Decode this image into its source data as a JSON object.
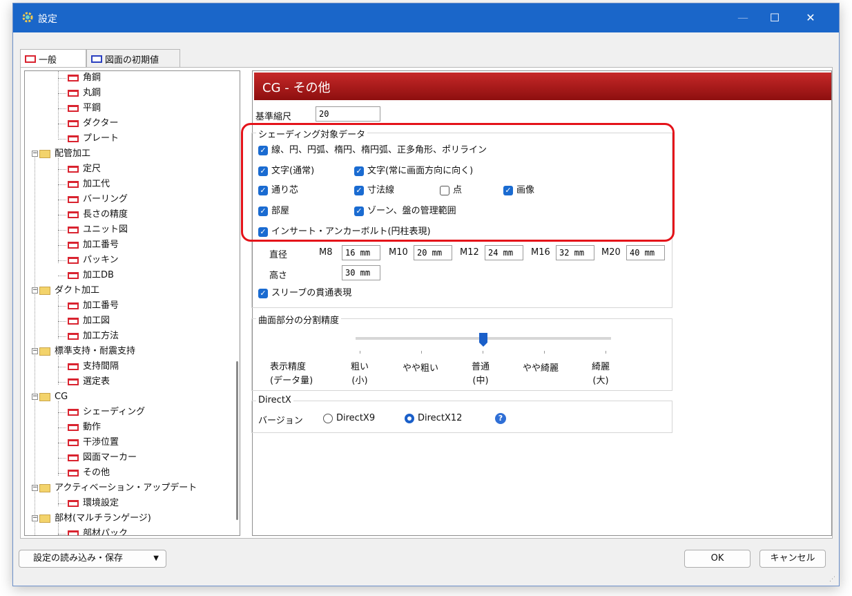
{
  "window": {
    "title": "設定",
    "min_glyph": "—",
    "max_glyph": "☐",
    "close_glyph": "✕"
  },
  "tabs": [
    {
      "label": "一般",
      "active": true
    },
    {
      "label": "図面の初期値",
      "active": false
    }
  ],
  "tree": {
    "items": [
      {
        "label": "角鋼",
        "kind": "leaf"
      },
      {
        "label": "丸鋼",
        "kind": "leaf"
      },
      {
        "label": "平鋼",
        "kind": "leaf"
      },
      {
        "label": "ダクター",
        "kind": "leaf"
      },
      {
        "label": "プレート",
        "kind": "leaf"
      },
      {
        "label": "配管加工",
        "kind": "folder"
      },
      {
        "label": "定尺",
        "kind": "leaf"
      },
      {
        "label": "加工代",
        "kind": "leaf"
      },
      {
        "label": "バーリング",
        "kind": "leaf"
      },
      {
        "label": "長さの精度",
        "kind": "leaf"
      },
      {
        "label": "ユニット図",
        "kind": "leaf"
      },
      {
        "label": "加工番号",
        "kind": "leaf"
      },
      {
        "label": "パッキン",
        "kind": "leaf"
      },
      {
        "label": "加工DB",
        "kind": "leaf"
      },
      {
        "label": "ダクト加工",
        "kind": "folder"
      },
      {
        "label": "加工番号",
        "kind": "leaf"
      },
      {
        "label": "加工図",
        "kind": "leaf"
      },
      {
        "label": "加工方法",
        "kind": "leaf"
      },
      {
        "label": "標準支持・耐震支持",
        "kind": "folder"
      },
      {
        "label": "支持間隔",
        "kind": "leaf"
      },
      {
        "label": "選定表",
        "kind": "leaf"
      },
      {
        "label": "CG",
        "kind": "folder"
      },
      {
        "label": "シェーディング",
        "kind": "leaf"
      },
      {
        "label": "動作",
        "kind": "leaf"
      },
      {
        "label": "干渉位置",
        "kind": "leaf"
      },
      {
        "label": "図面マーカー",
        "kind": "leaf"
      },
      {
        "label": "その他",
        "kind": "leaf"
      },
      {
        "label": "アクティベーション・アップデート",
        "kind": "folder"
      },
      {
        "label": "環境設定",
        "kind": "leaf"
      },
      {
        "label": "部材(マルチランゲージ)",
        "kind": "folder"
      },
      {
        "label": "部材パック",
        "kind": "leaf"
      }
    ],
    "expander_glyph": "−"
  },
  "panel": {
    "header": "CG - その他",
    "scale_label": "基準縮尺",
    "scale_value": "20",
    "shading": {
      "title": "シェーディング対象データ",
      "lines": "線、円、円弧、楕円、楕円弧、正多角形、ポリライン",
      "text_normal": "文字(通常)",
      "text_facing": "文字(常に画面方向に向く)",
      "core": "通り芯",
      "dimension": "寸法線",
      "point": "点",
      "image": "画像",
      "room": "部屋",
      "zone": "ゾーン、盤の管理範囲",
      "insert": "インサート・アンカーボルト(円柱表現)",
      "check_glyph": "✓"
    },
    "diameter_label": "直径",
    "diameters": [
      {
        "label": "M8",
        "value": "16 mm"
      },
      {
        "label": "M10",
        "value": "20 mm"
      },
      {
        "label": "M12",
        "value": "24 mm"
      },
      {
        "label": "M16",
        "value": "32 mm"
      },
      {
        "label": "M20",
        "value": "40 mm"
      }
    ],
    "height_label": "高さ",
    "height_value": "30 mm",
    "sleeve": "スリーブの貫通表現",
    "curve": {
      "title": "曲面部分の分割精度",
      "display_label": "表示精度\n(データ量)",
      "levels": [
        "粗い\n(小)",
        "やや粗い",
        "普通\n(中)",
        "やや綺麗",
        "綺麗\n(大)"
      ],
      "selected_index": 2
    },
    "directx": {
      "title": "DirectX",
      "version_label": "バージョン",
      "opt1": "DirectX9",
      "opt2": "DirectX12",
      "selected": "DirectX12",
      "help_glyph": "?"
    }
  },
  "footer": {
    "load_save": "設定の読み込み・保存",
    "dropdown_glyph": "▼",
    "ok": "OK",
    "cancel": "キャンセル",
    "grip_glyph": "⋰"
  },
  "colors": {
    "title_bar": "#1a66c9",
    "header_red": "#c62828",
    "check_blue": "#1a6bd1",
    "highlight": "#e4131a"
  }
}
